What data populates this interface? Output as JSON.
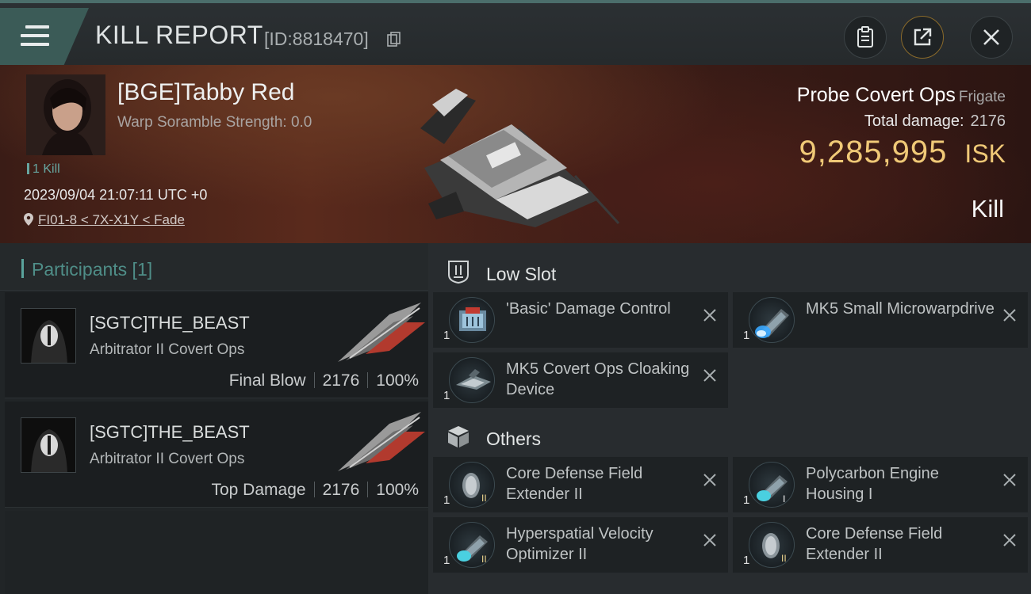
{
  "header": {
    "title": "KILL REPORT",
    "report_id": "[ID:8818470]"
  },
  "victim": {
    "name": "[BGE]Tabby Red",
    "scramble": "Warp Soramble Strength: 0.0",
    "kill_count": "1 Kill",
    "datetime": "2023/09/04 21:07:11 UTC +0",
    "location": "FI01-8 < 7X-X1Y < Fade",
    "ship_name": "Probe Covert Ops",
    "ship_class": "Frigate",
    "total_damage_label": "Total damage:",
    "total_damage": "2176",
    "isk_value": "9,285,995",
    "isk_unit": "ISK",
    "result": "Kill"
  },
  "participants": {
    "title": "Participants [1]",
    "rows": [
      {
        "name": "[SGTC]THE_BEAST",
        "ship": "Arbitrator II Covert Ops",
        "role": "Final Blow",
        "damage": "2176",
        "percent": "100%"
      },
      {
        "name": "[SGTC]THE_BEAST",
        "ship": "Arbitrator II Covert Ops",
        "role": "Top Damage",
        "damage": "2176",
        "percent": "100%"
      }
    ]
  },
  "fitting": {
    "low_slot": {
      "label": "Low Slot",
      "modules": [
        {
          "name": "'Basic' Damage Control",
          "qty": "1",
          "icon": "damage-control-icon"
        },
        {
          "name": "MK5 Small Microwarpdrive",
          "qty": "1",
          "icon": "microwarpdrive-icon"
        },
        {
          "name": "MK5 Covert Ops Cloaking Device",
          "qty": "1",
          "icon": "cloaking-device-icon"
        }
      ]
    },
    "others": {
      "label": "Others",
      "modules": [
        {
          "name": "Core Defense Field Extender II",
          "qty": "1",
          "icon": "shield-rig-icon",
          "tier": "II"
        },
        {
          "name": "Polycarbon Engine Housing I",
          "qty": "1",
          "icon": "engine-rig-icon",
          "tier": "I"
        },
        {
          "name": "Hyperspatial Velocity Optimizer II",
          "qty": "1",
          "icon": "velocity-rig-icon",
          "tier": "II"
        },
        {
          "name": "Core Defense Field Extender II",
          "qty": "1",
          "icon": "shield-rig-icon",
          "tier": "II"
        }
      ]
    }
  },
  "colors": {
    "accent_teal": "#5aa39c",
    "isk_gold": "#f0c977",
    "panel_dark": "#1e2224"
  }
}
